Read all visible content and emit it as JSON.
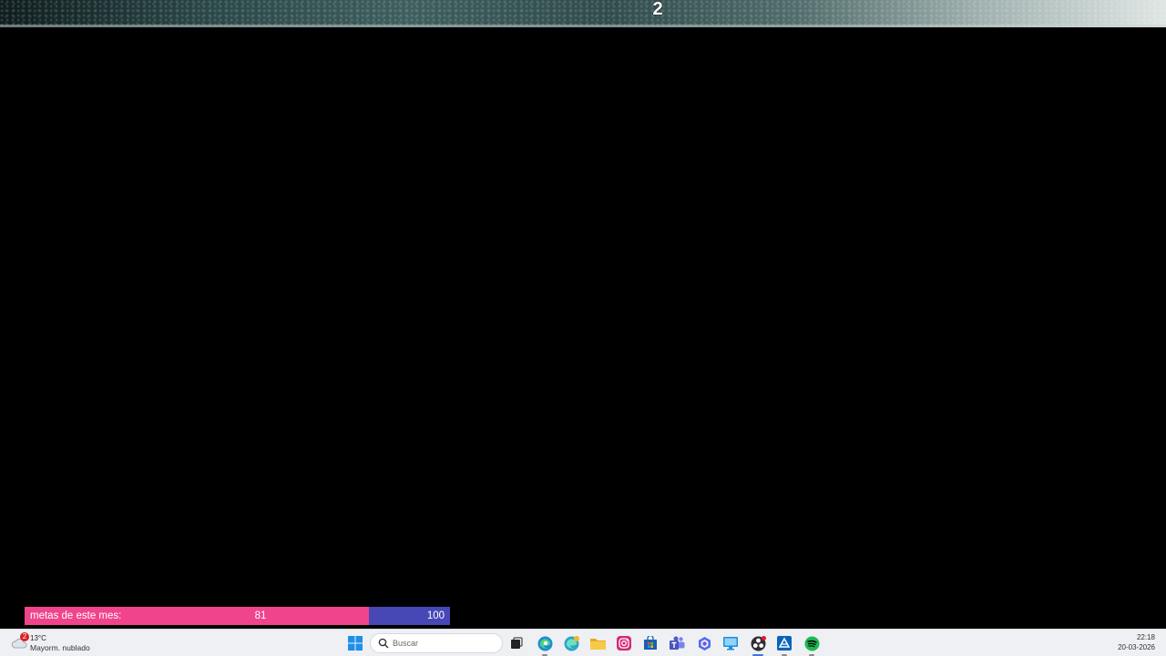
{
  "overlay": {
    "top_number": "2"
  },
  "goal": {
    "label": "metas de este mes:",
    "current": "81",
    "target": "100",
    "progress_fraction": 0.81,
    "fill_color": "#f0448c",
    "track_color": "#4747b5"
  },
  "taskbar": {
    "weather": {
      "badge": "2",
      "temperature": "13°C",
      "description": "Mayorm. nublado"
    },
    "search": {
      "placeholder": "Buscar"
    },
    "apps": [
      {
        "name": "start",
        "icon": "windows-logo-icon"
      },
      {
        "name": "task-view",
        "icon": "task-view-icon"
      },
      {
        "name": "edge",
        "icon": "edge-icon"
      },
      {
        "name": "edge-beta",
        "icon": "edge-beta-icon"
      },
      {
        "name": "file-explorer",
        "icon": "folder-icon"
      },
      {
        "name": "instagram",
        "icon": "instagram-icon"
      },
      {
        "name": "store",
        "icon": "store-icon"
      },
      {
        "name": "teams",
        "icon": "teams-icon"
      },
      {
        "name": "copilot",
        "icon": "copilot-icon"
      },
      {
        "name": "remote-desktop",
        "icon": "monitor-icon"
      },
      {
        "name": "obs",
        "icon": "obs-icon"
      },
      {
        "name": "azure-data-studio",
        "icon": "data-studio-icon"
      },
      {
        "name": "spotify",
        "icon": "spotify-icon"
      }
    ],
    "clock": {
      "time": "22:18",
      "date": "20-03-2026"
    }
  }
}
